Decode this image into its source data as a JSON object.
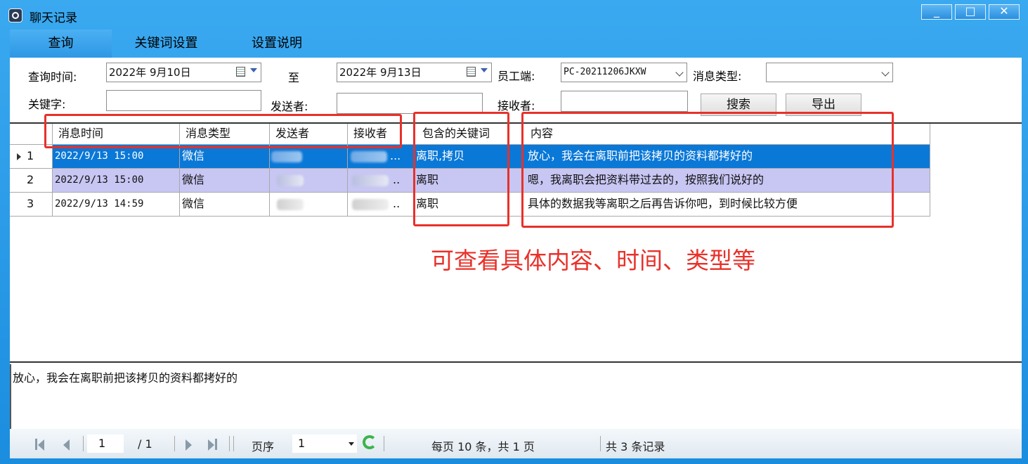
{
  "window": {
    "title": "聊天记录",
    "minimize": "_",
    "maximize": "□",
    "close": "✕"
  },
  "tabs": [
    "查询",
    "关键词设置",
    "设置说明"
  ],
  "filters": {
    "query_time_label": "查询时间:",
    "date_from": "2022年 9月10日",
    "to_label": "至",
    "date_to": "2022年 9月13日",
    "employee_label": "员工端:",
    "employee_value": "PC-20211206JKXW",
    "msg_type_label": "消息类型:",
    "msg_type_value": "",
    "keyword_label": "关键字:",
    "keyword_value": "",
    "sender_label": "发送者:",
    "sender_value": "",
    "receiver_label": "接收者:",
    "receiver_value": "",
    "search_button": "搜索",
    "export_button": "导出"
  },
  "table": {
    "columns": [
      "消息时间",
      "消息类型",
      "发送者",
      "接收者",
      "包含的关键词",
      "内容"
    ],
    "rows": [
      {
        "no": "1",
        "time": "2022/9/13 15:00",
        "type": "微信",
        "receiver_suffix": "...",
        "keywords": "离职,拷贝",
        "content": "放心，我会在离职前把该拷贝的资料都拷好的"
      },
      {
        "no": "2",
        "time": "2022/9/13 15:00",
        "type": "微信",
        "receiver_suffix": "..",
        "keywords": "离职",
        "content": "嗯，我离职会把资料带过去的，按照我们说好的"
      },
      {
        "no": "3",
        "time": "2022/9/13 14:59",
        "type": "微信",
        "receiver_suffix": "..",
        "keywords": "离职",
        "content": "具体的数据我等离职之后再告诉你吧，到时候比较方便"
      }
    ]
  },
  "detail_text": "放心，我会在离职前把该拷贝的资料都拷好的",
  "pager": {
    "current_page": "1",
    "total_pages": "/ 1",
    "page_order_label": "页序",
    "page_order_value": "1",
    "per_page_text": "每页 10 条，共 1 页",
    "total_records_text": "共 3 条记录"
  },
  "annotation": "可查看具体内容、时间、类型等",
  "colors": {
    "selected_row": "#0a78d7",
    "highlight_row": "#c8c6f3",
    "annotation_red": "#e8312a"
  }
}
